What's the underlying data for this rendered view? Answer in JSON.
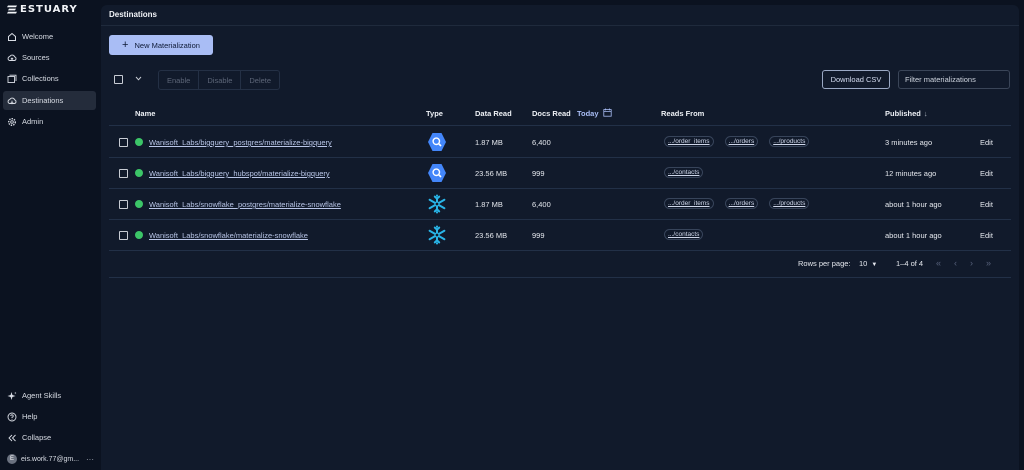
{
  "brand": {
    "name": "ESTUARY"
  },
  "sidebar": {
    "items": [
      {
        "label": "Welcome",
        "icon": "home-icon"
      },
      {
        "label": "Sources",
        "icon": "cloud-upload-icon"
      },
      {
        "label": "Collections",
        "icon": "collections-icon"
      },
      {
        "label": "Destinations",
        "icon": "cloud-download-icon",
        "active": true
      },
      {
        "label": "Admin",
        "icon": "gear-icon"
      }
    ],
    "bottom": [
      {
        "label": "Agent Skills",
        "icon": "sparkle-icon"
      },
      {
        "label": "Help",
        "icon": "help-icon"
      },
      {
        "label": "Collapse",
        "icon": "collapse-icon"
      }
    ],
    "user": {
      "initial": "E",
      "email": "eis.work.77@gm...",
      "more": "···"
    }
  },
  "page": {
    "title": "Destinations"
  },
  "toolbar": {
    "new_label": "New Materialization",
    "enable_label": "Enable",
    "disable_label": "Disable",
    "delete_label": "Delete",
    "download_label": "Download CSV",
    "filter_placeholder": "Filter materializations"
  },
  "table": {
    "headers": {
      "name": "Name",
      "type": "Type",
      "data_read": "Data Read",
      "docs_read": "Docs Read",
      "today": "Today",
      "reads_from": "Reads From",
      "published": "Published",
      "published_sort": "↓"
    },
    "rows": [
      {
        "name": "Wanisoft_Labs/bigquery_postgres/materialize-bigquery",
        "type": "bigquery",
        "data_read": "1.87 MB",
        "docs_read": "6,400",
        "reads_from": [
          ".../order_items",
          ".../orders",
          ".../products"
        ],
        "published": "3 minutes ago",
        "edit": "Edit",
        "status": "active"
      },
      {
        "name": "Wanisoft_Labs/bigquery_hubspot/materialize-bigquery",
        "type": "bigquery",
        "data_read": "23.56 MB",
        "docs_read": "999",
        "reads_from": [
          ".../contacts"
        ],
        "published": "12 minutes ago",
        "edit": "Edit",
        "status": "active"
      },
      {
        "name": "Wanisoft_Labs/snowflake_postgres/materialize-snowflake",
        "type": "snowflake",
        "data_read": "1.87 MB",
        "docs_read": "6,400",
        "reads_from": [
          ".../order_items",
          ".../orders",
          ".../products"
        ],
        "published": "about 1 hour ago",
        "edit": "Edit",
        "status": "active"
      },
      {
        "name": "Wanisoft_Labs/snowflake/materialize-snowflake",
        "type": "snowflake",
        "data_read": "23.56 MB",
        "docs_read": "999",
        "reads_from": [
          ".../contacts"
        ],
        "published": "about 1 hour ago",
        "edit": "Edit",
        "status": "active"
      }
    ]
  },
  "pagination": {
    "rows_per_page_label": "Rows per page:",
    "rows_per_page": "10",
    "range": "1–4 of 4"
  },
  "colors": {
    "accent": "#a9bdf5",
    "status_active": "#3cc568",
    "bigquery": "#4386fa",
    "snowflake": "#29b5e8"
  }
}
